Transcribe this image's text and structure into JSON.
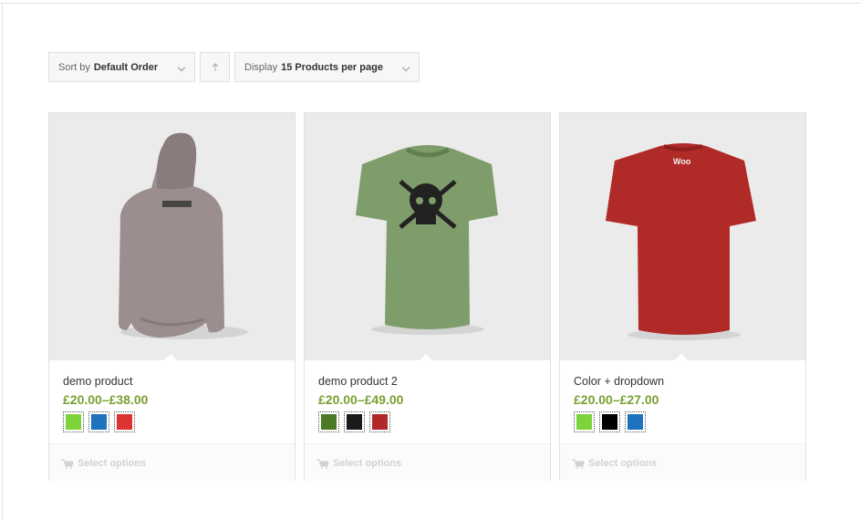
{
  "toolbar": {
    "sort_prefix": "Sort by",
    "sort_value": "Default Order",
    "direction_icon": "arrow-up-icon",
    "display_prefix": "Display",
    "display_value": "15 Products per page"
  },
  "products": [
    {
      "title": "demo product",
      "price": "£20.00–£38.00",
      "swatches": [
        "#7ed33a",
        "#1e73be",
        "#dd3333"
      ],
      "button": "Select options",
      "image": "hoodie-back-image"
    },
    {
      "title": "demo product 2",
      "price": "£20.00–£49.00",
      "swatches": [
        "#4a7a25",
        "#1a1a1a",
        "#b3272a"
      ],
      "button": "Select options",
      "image": "green-tshirt-image"
    },
    {
      "title": "Color + dropdown",
      "price": "£20.00–£27.00",
      "swatches": [
        "#7ed33a",
        "#000000",
        "#1e73be"
      ],
      "button": "Select options",
      "image": "red-tshirt-image"
    }
  ],
  "colors": {
    "price": "#77a132",
    "panel": "#ebebeb"
  }
}
